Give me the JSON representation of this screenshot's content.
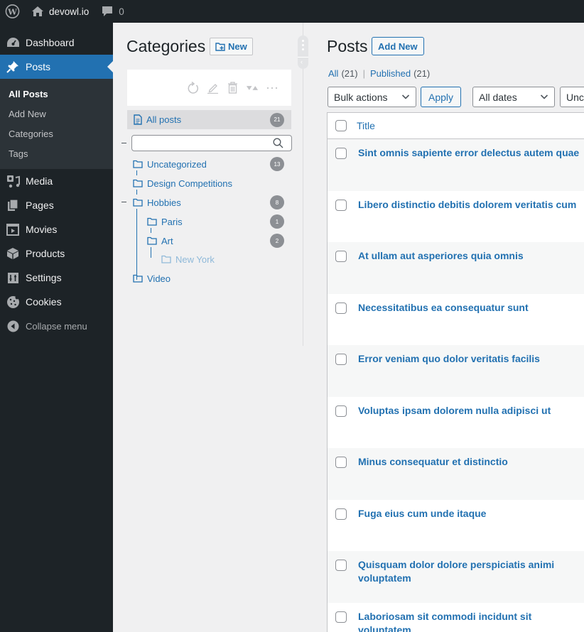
{
  "adminbar": {
    "site_name": "devowl.io",
    "comments_count": "0"
  },
  "sidebar": {
    "items": [
      {
        "label": "Dashboard",
        "icon": "dashboard-icon"
      },
      {
        "label": "Posts",
        "icon": "pin-icon",
        "current": true
      },
      {
        "label": "Media",
        "icon": "media-icon"
      },
      {
        "label": "Pages",
        "icon": "pages-icon"
      },
      {
        "label": "Movies",
        "icon": "movies-icon"
      },
      {
        "label": "Products",
        "icon": "box-icon"
      },
      {
        "label": "Settings",
        "icon": "settings-icon"
      },
      {
        "label": "Cookies",
        "icon": "cookie-icon"
      }
    ],
    "submenu": [
      {
        "label": "All Posts",
        "current": true
      },
      {
        "label": "Add New"
      },
      {
        "label": "Categories"
      },
      {
        "label": "Tags"
      }
    ],
    "collapse_label": "Collapse menu"
  },
  "categories": {
    "title": "Categories",
    "new_label": "New",
    "all_posts": {
      "label": "All posts",
      "count": "21"
    },
    "search_placeholder": "",
    "tree": [
      {
        "label": "Uncategorized",
        "count": "13"
      },
      {
        "label": "Design Competitions",
        "count": ""
      },
      {
        "label": "Hobbies",
        "count": "8"
      },
      {
        "label": "Paris",
        "count": "1"
      },
      {
        "label": "Art",
        "count": "2"
      },
      {
        "label": "New York",
        "count": ""
      },
      {
        "label": "Video",
        "count": ""
      }
    ]
  },
  "posts": {
    "title": "Posts",
    "add_new_label": "Add New",
    "filters": {
      "all_label": "All",
      "all_count": "(21)",
      "published_label": "Published",
      "published_count": "(21)",
      "separator": "|"
    },
    "bulk_actions": "Bulk actions",
    "apply_label": "Apply",
    "dates": "All dates",
    "category_filter": "Unc",
    "column_title": "Title",
    "rows": [
      "Sint omnis sapiente error delectus autem quae",
      "Libero distinctio debitis dolorem veritatis cum",
      "At ullam aut asperiores quia omnis",
      "Necessitatibus ea consequatur sunt",
      "Error veniam quo dolor veritatis facilis",
      "Voluptas ipsam dolorem nulla adipisci ut",
      "Minus consequatur et distinctio",
      "Fuga eius cum unde itaque",
      "Quisquam dolor dolore perspiciatis animi voluptatem",
      "Laboriosam sit commodi incidunt sit voluptatem"
    ]
  },
  "colors": {
    "accent": "#2271b1",
    "adminbar_bg": "#1d2327",
    "submenu_bg": "#2c3338",
    "page_bg": "#f0f0f1",
    "badge": "#8c8f94"
  }
}
